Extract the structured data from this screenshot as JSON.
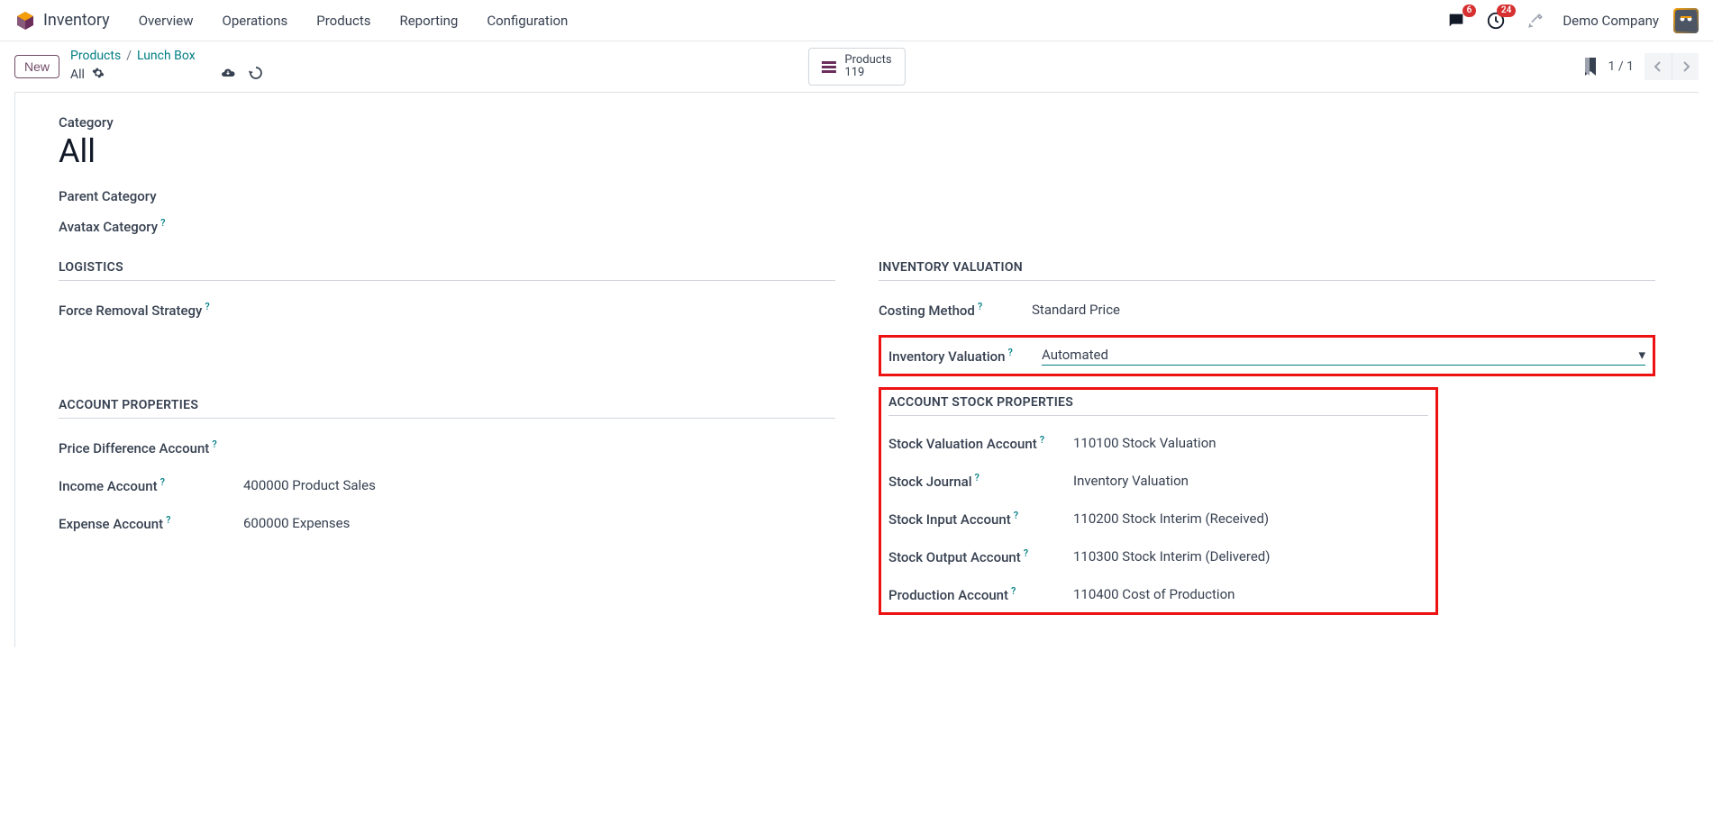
{
  "nav": {
    "app_name": "Inventory",
    "menu": [
      "Overview",
      "Operations",
      "Products",
      "Reporting",
      "Configuration"
    ],
    "messages_badge": "6",
    "activities_badge": "24",
    "company": "Demo Company"
  },
  "cp": {
    "new_btn": "New",
    "breadcrumb": {
      "products": "Products",
      "current": "Lunch Box",
      "all": "All"
    },
    "stat": {
      "label": "Products",
      "count": "119"
    },
    "pager": "1 / 1"
  },
  "form": {
    "category_label": "Category",
    "category_value": "All",
    "parent_label": "Parent Category",
    "avatax_label": "Avatax Category",
    "sections": {
      "logistics": "Logistics",
      "inventory_valuation": "Inventory Valuation",
      "account_properties": "Account Properties",
      "account_stock": "Account Stock Properties"
    },
    "logistics": {
      "force_removal": "Force Removal Strategy"
    },
    "inv_val": {
      "costing_method_label": "Costing Method",
      "costing_method_value": "Standard Price",
      "inventory_valuation_label": "Inventory Valuation",
      "inventory_valuation_value": "Automated"
    },
    "acct_props": {
      "price_diff_label": "Price Difference Account",
      "income_label": "Income Account",
      "income_value": "400000 Product Sales",
      "expense_label": "Expense Account",
      "expense_value": "600000 Expenses"
    },
    "stock_props": {
      "valuation_label": "Stock Valuation Account",
      "valuation_value": "110100 Stock Valuation",
      "journal_label": "Stock Journal",
      "journal_value": "Inventory Valuation",
      "input_label": "Stock Input Account",
      "input_value": "110200 Stock Interim (Received)",
      "output_label": "Stock Output Account",
      "output_value": "110300 Stock Interim (Delivered)",
      "production_label": "Production Account",
      "production_value": "110400 Cost of Production"
    }
  }
}
